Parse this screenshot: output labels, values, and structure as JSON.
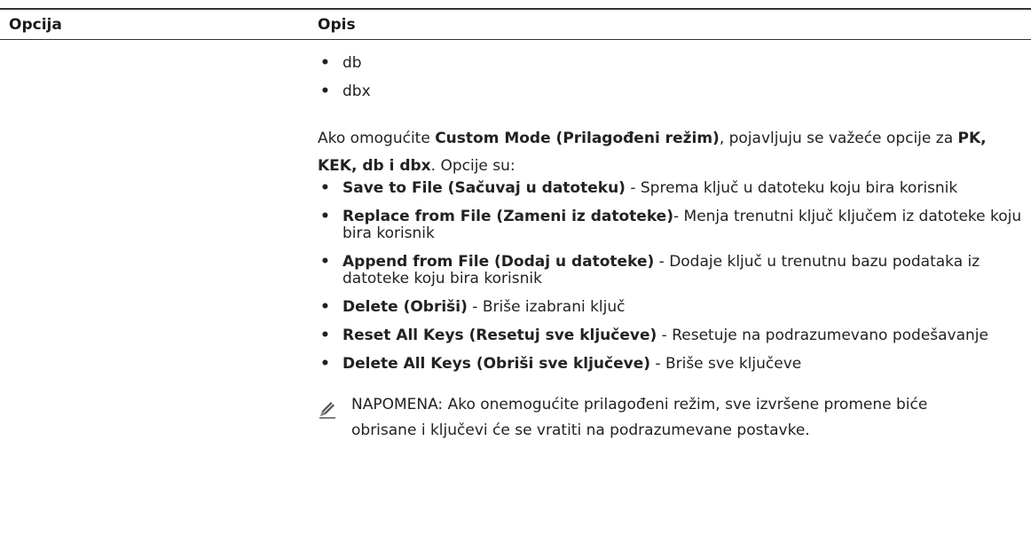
{
  "table": {
    "header_option": "Opcija",
    "header_description": "Opis"
  },
  "simple_list": [
    "db",
    "dbx"
  ],
  "paragraph": {
    "part1": "Ako omogućite ",
    "bold1": "Custom Mode (Prilagođeni režim)",
    "part2": ", pojavljuju se važeće opcije za ",
    "bold2": "PK, KEK, db i dbx",
    "part3": ". Opcije su:"
  },
  "options": [
    {
      "term": "Save to File (Sačuvaj u datoteku)",
      "desc": " - Sprema ključ u datoteku koju bira korisnik"
    },
    {
      "term": "Replace from File (Zameni iz datoteke)",
      "desc": "- Menja trenutni ključ ključem iz datoteke koju bira korisnik"
    },
    {
      "term": "Append from File (Dodaj u datoteke)",
      "desc": " - Dodaje ključ u trenutnu bazu podataka iz datoteke koju bira korisnik"
    },
    {
      "term": "Delete (Obriši)",
      "desc": " - Briše izabrani ključ"
    },
    {
      "term": "Reset All Keys (Resetuj sve ključeve)",
      "desc": " - Resetuje na podrazumevano podešavanje"
    },
    {
      "term": "Delete All Keys (Obriši sve ključeve)",
      "desc": " - Briše sve ključeve"
    }
  ],
  "note": {
    "label": "NAPOMENA:",
    "text": " Ako onemogućite prilagođeni režim, sve izvršene promene biće obrisane i ključevi će se vratiti na podrazumevane postavke."
  },
  "icons": {
    "note": "pencil-note-icon",
    "bullet": "•"
  },
  "colors": {
    "text": "#222222",
    "rule": "#333333"
  }
}
